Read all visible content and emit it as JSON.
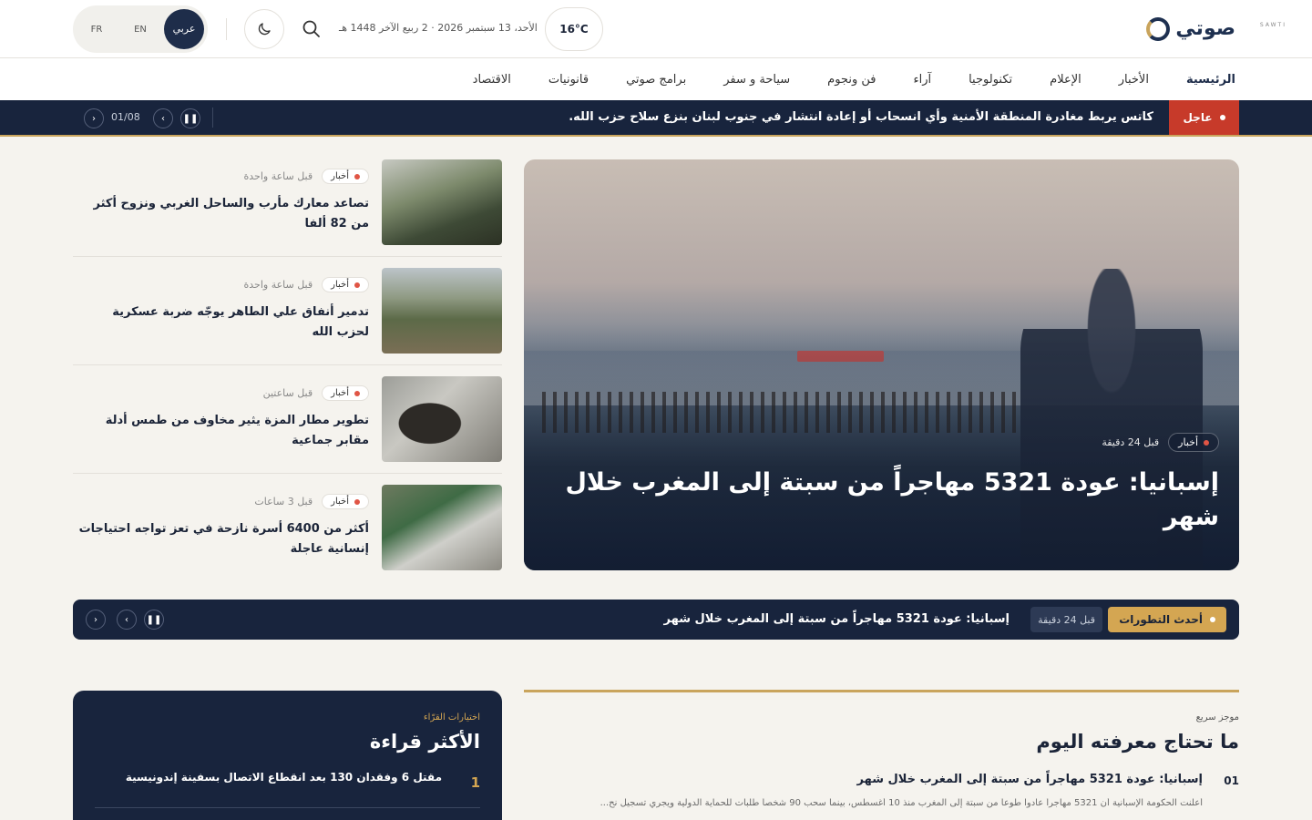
{
  "header": {
    "logo_text": "صوتي",
    "logo_sub": "SAWTI",
    "weather": "16°C",
    "date": "الأحد، 13 سبتمبر 2026 · 2 ربيع الآخر 1448 هـ",
    "languages": [
      "عربي",
      "EN",
      "FR"
    ]
  },
  "nav": [
    "الرئيسية",
    "الأخبار",
    "الإعلام",
    "تكنولوجيا",
    "آراء",
    "فن ونجوم",
    "سياحة و سفر",
    "برامج صوتي",
    "قانونيات",
    "الاقتصاد"
  ],
  "breaking": {
    "label": "عاجل",
    "text": "كاتس يربط مغادرة المنطقة الأمنية وأي انسحاب أو إعادة انتشار في جنوب لبنان بنزع سلاح حزب الله.",
    "counter": "01/08"
  },
  "hero": {
    "category": "أخبار",
    "time": "قبل 24 دقيقة",
    "title": "إسبانيا: عودة 5321 مهاجراً من سبتة إلى المغرب خلال شهر"
  },
  "side_news": [
    {
      "category": "أخبار",
      "time": "قبل ساعة واحدة",
      "title": "تصاعد معارك مأرب والساحل الغربي ونزوح أكثر من 82 ألفا"
    },
    {
      "category": "أخبار",
      "time": "قبل ساعة واحدة",
      "title": "تدمير أنفاق علي الطاهر يوجّه ضربة عسكرية لحزب الله"
    },
    {
      "category": "أخبار",
      "time": "قبل ساعتين",
      "title": "تطوير مطار المزة يثير مخاوف من طمس أدلة مقابر جماعية"
    },
    {
      "category": "أخبار",
      "time": "قبل 3 ساعات",
      "title": "أكثر من 6400 أسرة نازحة في تعز تواجه احتياجات إنسانية عاجلة"
    }
  ],
  "developments": {
    "label": "أحدث التطورات",
    "time": "قبل 24 دقيقة",
    "text": "إسبانيا: عودة 5321 مهاجراً من سبتة إلى المغرب خلال شهر"
  },
  "brief": {
    "kicker": "موجز سريع",
    "title": "ما تحتاج معرفته اليوم",
    "items": [
      {
        "num": "01",
        "title": "إسبانيا: عودة 5321 مهاجراً من سبتة إلى المغرب خلال شهر",
        "desc": "أعلنت الحكومة الإسبانية أن 5321 مهاجراً عادوا طوعاً من سبتة إلى المغرب منذ 10 أغسطس، بينما سحب 90 شخصاً طلبات للحماية الدولية ويجري تسجيل نح..."
      }
    ]
  },
  "popular": {
    "kicker": "اختيارات القرّاء",
    "title": "الأكثر قراءة",
    "items": [
      {
        "num": "1",
        "title": "مقتل 6 وفقدان 130 بعد انقطاع الاتصال بسفينة إندونيسية"
      }
    ]
  },
  "colors": {
    "navy": "#18243d",
    "gold": "#c9a45c",
    "breaking_red": "#c73a2a"
  }
}
